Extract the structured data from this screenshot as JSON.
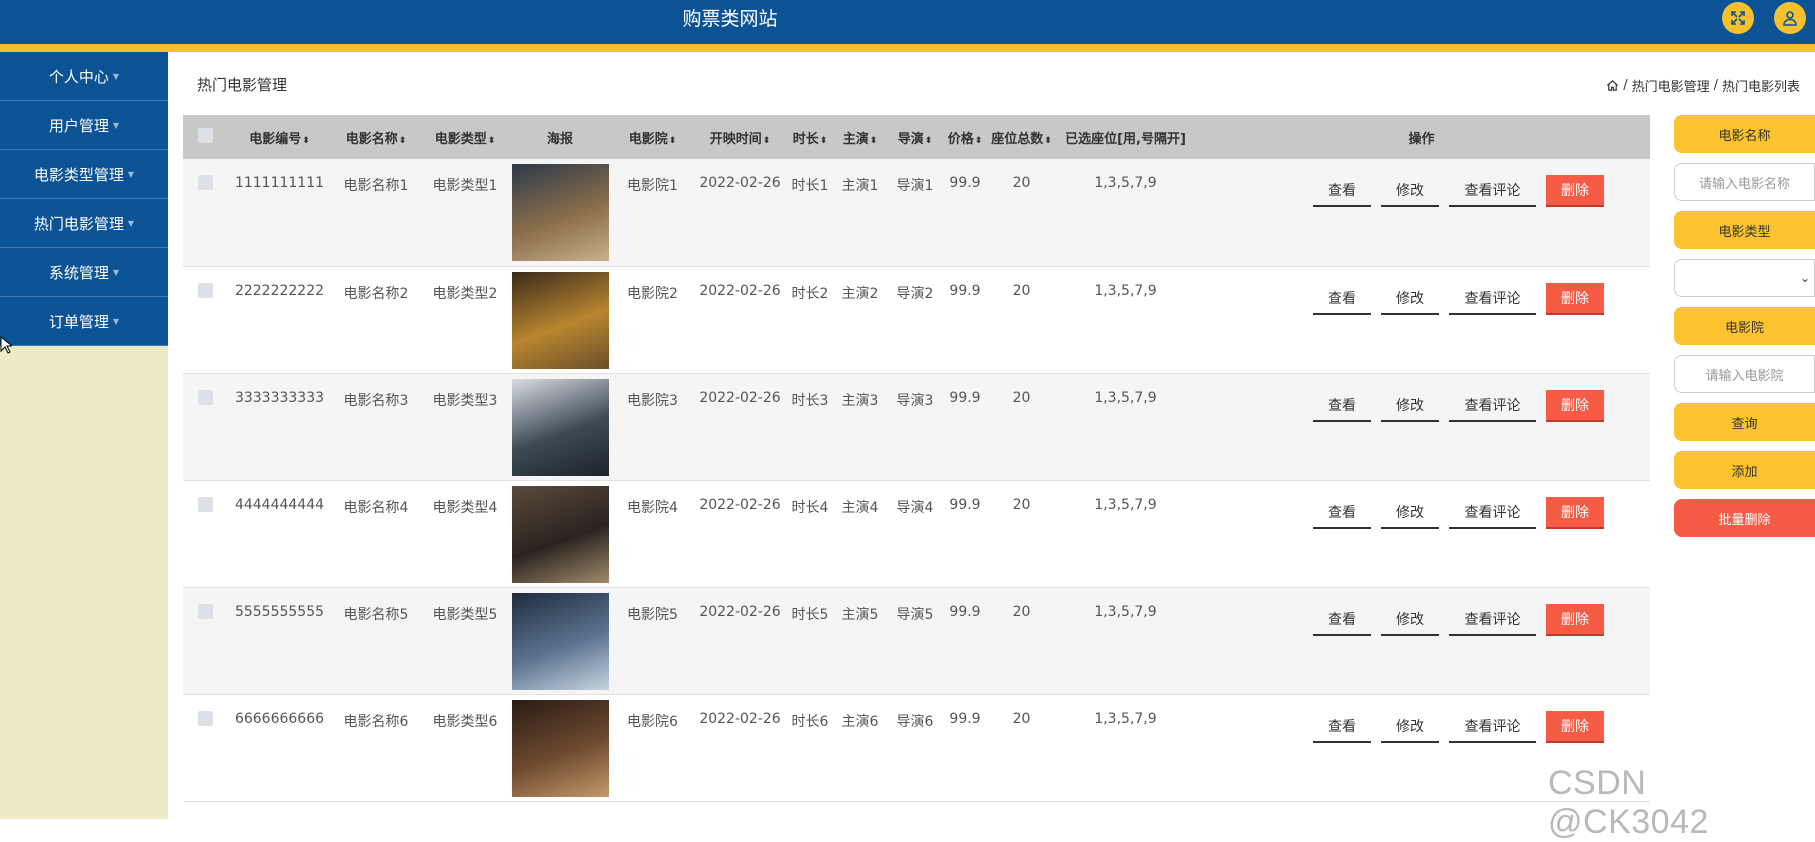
{
  "header": {
    "title": "购票类网站",
    "fullscreen_icon": "fullscreen-icon",
    "user_icon": "user-icon"
  },
  "sidebar": {
    "items": [
      {
        "label": "个人中心"
      },
      {
        "label": "用户管理"
      },
      {
        "label": "电影类型管理"
      },
      {
        "label": "热门电影管理"
      },
      {
        "label": "系统管理"
      },
      {
        "label": "订单管理"
      }
    ]
  },
  "page": {
    "title": "热门电影管理",
    "breadcrumb": [
      "热门电影管理",
      "热门电影列表"
    ],
    "breadcrumb_sep": "/"
  },
  "table": {
    "columns": [
      "电影编号",
      "电影名称",
      "电影类型",
      "海报",
      "电影院",
      "开映时间",
      "时长",
      "主演",
      "导演",
      "价格",
      "座位总数",
      "已选座位[用,号隔开]",
      "操作"
    ],
    "rows": [
      {
        "id": "1111111111",
        "name": "电影名称1",
        "type": "电影类型1",
        "cinema": "电影院1",
        "time": "2022-02-26",
        "duration": "时长1",
        "actor": "主演1",
        "director": "导演1",
        "price": "99.9",
        "seats": "20",
        "selected": "1,3,5,7,9"
      },
      {
        "id": "2222222222",
        "name": "电影名称2",
        "type": "电影类型2",
        "cinema": "电影院2",
        "time": "2022-02-26",
        "duration": "时长2",
        "actor": "主演2",
        "director": "导演2",
        "price": "99.9",
        "seats": "20",
        "selected": "1,3,5,7,9"
      },
      {
        "id": "3333333333",
        "name": "电影名称3",
        "type": "电影类型3",
        "cinema": "电影院3",
        "time": "2022-02-26",
        "duration": "时长3",
        "actor": "主演3",
        "director": "导演3",
        "price": "99.9",
        "seats": "20",
        "selected": "1,3,5,7,9"
      },
      {
        "id": "4444444444",
        "name": "电影名称4",
        "type": "电影类型4",
        "cinema": "电影院4",
        "time": "2022-02-26",
        "duration": "时长4",
        "actor": "主演4",
        "director": "导演4",
        "price": "99.9",
        "seats": "20",
        "selected": "1,3,5,7,9"
      },
      {
        "id": "5555555555",
        "name": "电影名称5",
        "type": "电影类型5",
        "cinema": "电影院5",
        "time": "2022-02-26",
        "duration": "时长5",
        "actor": "主演5",
        "director": "导演5",
        "price": "99.9",
        "seats": "20",
        "selected": "1,3,5,7,9"
      },
      {
        "id": "6666666666",
        "name": "电影名称6",
        "type": "电影类型6",
        "cinema": "电影院6",
        "time": "2022-02-26",
        "duration": "时长6",
        "actor": "主演6",
        "director": "导演6",
        "price": "99.9",
        "seats": "20",
        "selected": "1,3,5,7,9"
      }
    ],
    "actions": {
      "view": "查看",
      "edit": "修改",
      "comments": "查看评论",
      "delete": "删除"
    }
  },
  "search_panel": {
    "name_label": "电影名称",
    "name_placeholder": "请输入电影名称",
    "type_label": "电影类型",
    "type_value": "",
    "cinema_label": "电影院",
    "cinema_placeholder": "请输入电影院",
    "query_button": "查询",
    "add_button": "添加",
    "batch_delete_button": "批量删除"
  },
  "watermark": "CSDN @CK3042",
  "colors": {
    "header_bg": "#0b5394",
    "accent_yellow": "#fbc42e",
    "danger_red": "#f55b45",
    "sidebar_bg": "#edebc5",
    "table_header_bg": "#c8c8c8"
  }
}
